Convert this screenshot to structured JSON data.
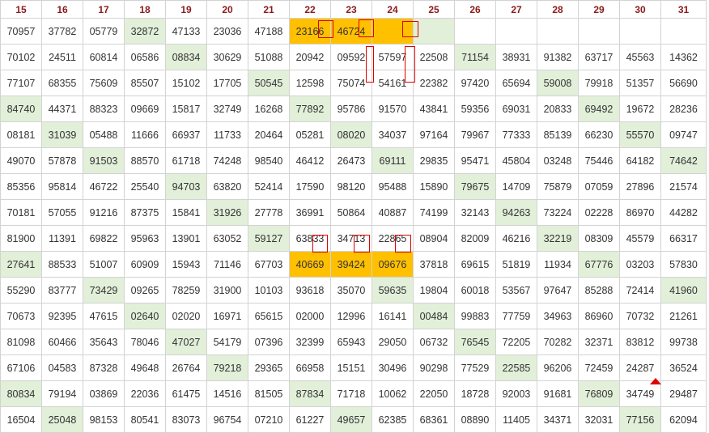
{
  "columns": [
    "15",
    "16",
    "17",
    "18",
    "19",
    "20",
    "21",
    "22",
    "23",
    "24",
    "25",
    "26",
    "27",
    "28",
    "29",
    "30",
    "31"
  ],
  "rows": [
    [
      {
        "v": "70957"
      },
      {
        "v": "37782"
      },
      {
        "v": "05779"
      },
      {
        "v": "32872",
        "bg": "g"
      },
      {
        "v": "47133"
      },
      {
        "v": "23036"
      },
      {
        "v": "47188"
      },
      {
        "v": "23166",
        "bg": "o"
      },
      {
        "v": "46724",
        "bg": "o"
      },
      {
        "v": "",
        "bg": "o"
      },
      {
        "v": "",
        "bg": "g"
      },
      {
        "v": "",
        "bg": "w"
      },
      {
        "v": "",
        "bg": "w"
      },
      {
        "v": "",
        "bg": "w"
      },
      {
        "v": "",
        "bg": "w"
      },
      {
        "v": "",
        "bg": "w"
      },
      {
        "v": "",
        "bg": "w"
      }
    ],
    [
      {
        "v": "70102"
      },
      {
        "v": "24511"
      },
      {
        "v": "60814"
      },
      {
        "v": "06586"
      },
      {
        "v": "08834",
        "bg": "g"
      },
      {
        "v": "30629"
      },
      {
        "v": "51088"
      },
      {
        "v": "20942"
      },
      {
        "v": "09592"
      },
      {
        "v": "57597"
      },
      {
        "v": "22508"
      },
      {
        "v": "71154",
        "bg": "g"
      },
      {
        "v": "38931"
      },
      {
        "v": "91382"
      },
      {
        "v": "63717"
      },
      {
        "v": "45563"
      },
      {
        "v": "14362"
      }
    ],
    [
      {
        "v": "77107"
      },
      {
        "v": "68355"
      },
      {
        "v": "75609"
      },
      {
        "v": "85507"
      },
      {
        "v": "15102"
      },
      {
        "v": "17705"
      },
      {
        "v": "50545",
        "bg": "g"
      },
      {
        "v": "12598"
      },
      {
        "v": "75074"
      },
      {
        "v": "54161"
      },
      {
        "v": "22382"
      },
      {
        "v": "97420"
      },
      {
        "v": "65694"
      },
      {
        "v": "59008",
        "bg": "g"
      },
      {
        "v": "79918"
      },
      {
        "v": "51357"
      },
      {
        "v": "56690"
      }
    ],
    [
      {
        "v": "84740",
        "bg": "g"
      },
      {
        "v": "44371"
      },
      {
        "v": "88323"
      },
      {
        "v": "09669"
      },
      {
        "v": "15817"
      },
      {
        "v": "32749"
      },
      {
        "v": "16268"
      },
      {
        "v": "77892",
        "bg": "g"
      },
      {
        "v": "95786"
      },
      {
        "v": "91570"
      },
      {
        "v": "43841"
      },
      {
        "v": "59356"
      },
      {
        "v": "69031"
      },
      {
        "v": "20833"
      },
      {
        "v": "69492",
        "bg": "g"
      },
      {
        "v": "19672"
      },
      {
        "v": "28236"
      }
    ],
    [
      {
        "v": "08181"
      },
      {
        "v": "31039",
        "bg": "g"
      },
      {
        "v": "05488"
      },
      {
        "v": "11666"
      },
      {
        "v": "66937"
      },
      {
        "v": "11733"
      },
      {
        "v": "20464"
      },
      {
        "v": "05281"
      },
      {
        "v": "08020",
        "bg": "g"
      },
      {
        "v": "34037"
      },
      {
        "v": "97164"
      },
      {
        "v": "79967"
      },
      {
        "v": "77333"
      },
      {
        "v": "85139"
      },
      {
        "v": "66230"
      },
      {
        "v": "55570",
        "bg": "g"
      },
      {
        "v": "09747"
      }
    ],
    [
      {
        "v": "49070"
      },
      {
        "v": "57878"
      },
      {
        "v": "91503",
        "bg": "g"
      },
      {
        "v": "88570"
      },
      {
        "v": "61718"
      },
      {
        "v": "74248"
      },
      {
        "v": "98540"
      },
      {
        "v": "46412"
      },
      {
        "v": "26473"
      },
      {
        "v": "69111",
        "bg": "g"
      },
      {
        "v": "29835"
      },
      {
        "v": "95471"
      },
      {
        "v": "45804"
      },
      {
        "v": "03248"
      },
      {
        "v": "75446"
      },
      {
        "v": "64182"
      },
      {
        "v": "74642",
        "bg": "g"
      }
    ],
    [
      {
        "v": "85356"
      },
      {
        "v": "95814"
      },
      {
        "v": "46722"
      },
      {
        "v": "25540"
      },
      {
        "v": "94703",
        "bg": "g"
      },
      {
        "v": "63820"
      },
      {
        "v": "52414"
      },
      {
        "v": "17590"
      },
      {
        "v": "98120"
      },
      {
        "v": "95488"
      },
      {
        "v": "15890"
      },
      {
        "v": "79675",
        "bg": "g"
      },
      {
        "v": "14709"
      },
      {
        "v": "75879"
      },
      {
        "v": "07059"
      },
      {
        "v": "27896"
      },
      {
        "v": "21574"
      }
    ],
    [
      {
        "v": "70181"
      },
      {
        "v": "57055"
      },
      {
        "v": "91216"
      },
      {
        "v": "87375"
      },
      {
        "v": "15841"
      },
      {
        "v": "31926",
        "bg": "g"
      },
      {
        "v": "27778"
      },
      {
        "v": "36991"
      },
      {
        "v": "50864"
      },
      {
        "v": "40887"
      },
      {
        "v": "74199"
      },
      {
        "v": "32143"
      },
      {
        "v": "94263",
        "bg": "g"
      },
      {
        "v": "73224"
      },
      {
        "v": "02228"
      },
      {
        "v": "86970"
      },
      {
        "v": "44282"
      }
    ],
    [
      {
        "v": "81900"
      },
      {
        "v": "11391"
      },
      {
        "v": "69822"
      },
      {
        "v": "95963"
      },
      {
        "v": "13901"
      },
      {
        "v": "63052"
      },
      {
        "v": "59127",
        "bg": "g"
      },
      {
        "v": "63833"
      },
      {
        "v": "34713"
      },
      {
        "v": "22865"
      },
      {
        "v": "08904"
      },
      {
        "v": "82009"
      },
      {
        "v": "46216"
      },
      {
        "v": "32219",
        "bg": "g"
      },
      {
        "v": "08309"
      },
      {
        "v": "45579"
      },
      {
        "v": "66317"
      }
    ],
    [
      {
        "v": "27641",
        "bg": "g"
      },
      {
        "v": "88533"
      },
      {
        "v": "51007"
      },
      {
        "v": "60909"
      },
      {
        "v": "15943"
      },
      {
        "v": "71146"
      },
      {
        "v": "67703"
      },
      {
        "v": "40669",
        "bg": "o"
      },
      {
        "v": "39424",
        "bg": "o"
      },
      {
        "v": "09676",
        "bg": "o"
      },
      {
        "v": "37818"
      },
      {
        "v": "69615"
      },
      {
        "v": "51819"
      },
      {
        "v": "11934"
      },
      {
        "v": "67776",
        "bg": "g"
      },
      {
        "v": "03203"
      },
      {
        "v": "57830"
      }
    ],
    [
      {
        "v": "55290"
      },
      {
        "v": "83777"
      },
      {
        "v": "73429",
        "bg": "g"
      },
      {
        "v": "09265"
      },
      {
        "v": "78259"
      },
      {
        "v": "31900"
      },
      {
        "v": "10103"
      },
      {
        "v": "93618"
      },
      {
        "v": "35070"
      },
      {
        "v": "59635",
        "bg": "g"
      },
      {
        "v": "19804"
      },
      {
        "v": "60018"
      },
      {
        "v": "53567"
      },
      {
        "v": "97647"
      },
      {
        "v": "85288"
      },
      {
        "v": "72414"
      },
      {
        "v": "41960",
        "bg": "g"
      }
    ],
    [
      {
        "v": "70673"
      },
      {
        "v": "92395"
      },
      {
        "v": "47615"
      },
      {
        "v": "02640",
        "bg": "g"
      },
      {
        "v": "02020"
      },
      {
        "v": "16971"
      },
      {
        "v": "65615"
      },
      {
        "v": "02000"
      },
      {
        "v": "12996"
      },
      {
        "v": "16141"
      },
      {
        "v": "00484",
        "bg": "g"
      },
      {
        "v": "99883"
      },
      {
        "v": "77759"
      },
      {
        "v": "34963"
      },
      {
        "v": "86960"
      },
      {
        "v": "70732"
      },
      {
        "v": "21261"
      }
    ],
    [
      {
        "v": "81098"
      },
      {
        "v": "60466"
      },
      {
        "v": "35643"
      },
      {
        "v": "78046"
      },
      {
        "v": "47027",
        "bg": "g"
      },
      {
        "v": "54179"
      },
      {
        "v": "07396"
      },
      {
        "v": "32399"
      },
      {
        "v": "65943"
      },
      {
        "v": "29050"
      },
      {
        "v": "06732"
      },
      {
        "v": "76545",
        "bg": "g"
      },
      {
        "v": "72205"
      },
      {
        "v": "70282"
      },
      {
        "v": "32371"
      },
      {
        "v": "83812"
      },
      {
        "v": "99738"
      }
    ],
    [
      {
        "v": "67106"
      },
      {
        "v": "04583"
      },
      {
        "v": "87328"
      },
      {
        "v": "49648"
      },
      {
        "v": "26764"
      },
      {
        "v": "79218",
        "bg": "g"
      },
      {
        "v": "29365"
      },
      {
        "v": "66958"
      },
      {
        "v": "15151"
      },
      {
        "v": "30496"
      },
      {
        "v": "90298"
      },
      {
        "v": "77529"
      },
      {
        "v": "22585",
        "bg": "g"
      },
      {
        "v": "96206"
      },
      {
        "v": "72459"
      },
      {
        "v": "24287"
      },
      {
        "v": "36524"
      }
    ],
    [
      {
        "v": "80834",
        "bg": "g"
      },
      {
        "v": "79194"
      },
      {
        "v": "03869"
      },
      {
        "v": "22036"
      },
      {
        "v": "61475"
      },
      {
        "v": "14516"
      },
      {
        "v": "81505"
      },
      {
        "v": "87834",
        "bg": "g"
      },
      {
        "v": "71718"
      },
      {
        "v": "10062"
      },
      {
        "v": "22050"
      },
      {
        "v": "18728"
      },
      {
        "v": "92003"
      },
      {
        "v": "91681"
      },
      {
        "v": "76809",
        "bg": "g"
      },
      {
        "v": "34749"
      },
      {
        "v": "29487"
      }
    ],
    [
      {
        "v": "16504"
      },
      {
        "v": "25048",
        "bg": "g"
      },
      {
        "v": "98153"
      },
      {
        "v": "80541"
      },
      {
        "v": "83073"
      },
      {
        "v": "96754"
      },
      {
        "v": "07210"
      },
      {
        "v": "61227"
      },
      {
        "v": "49657",
        "bg": "g"
      },
      {
        "v": "62385"
      },
      {
        "v": "68361"
      },
      {
        "v": "08890"
      },
      {
        "v": "11405"
      },
      {
        "v": "34371"
      },
      {
        "v": "32031"
      },
      {
        "v": "77156",
        "bg": "g"
      },
      {
        "v": "62094"
      }
    ]
  ],
  "colors": {
    "header_text": "#8b1a1a",
    "green_cell": "#e2efd9",
    "orange_cell": "#ffc000",
    "red_mark": "#e00000"
  }
}
